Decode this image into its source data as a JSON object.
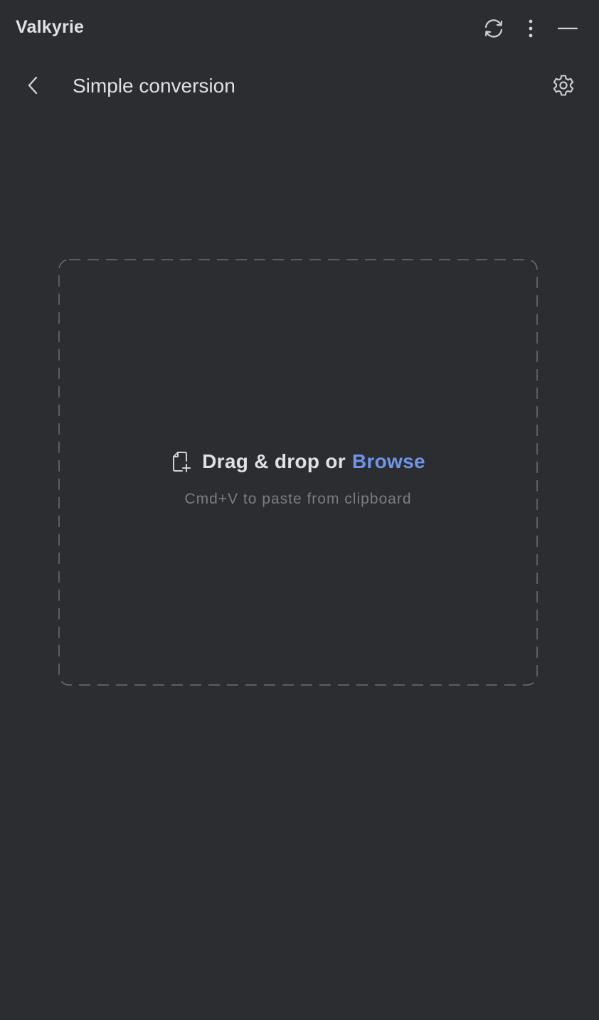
{
  "app": {
    "title": "Valkyrie"
  },
  "titlebar": {
    "icons": [
      "sync-icon",
      "more-vertical-icon",
      "minimize-icon"
    ]
  },
  "header": {
    "back_icon": "chevron-left-icon",
    "title": "Simple conversion",
    "settings_icon": "gear-icon"
  },
  "dropzone": {
    "icon": "file-add-icon",
    "drag_text": "Drag & drop or",
    "browse_label": "Browse",
    "paste_hint": "Cmd+V to paste from clipboard"
  },
  "colors": {
    "background": "#2b2d30",
    "text": "#dfe1e5",
    "accent": "#6f95eb",
    "muted": "#7b7d82",
    "dash_border": "#6b6e75"
  }
}
